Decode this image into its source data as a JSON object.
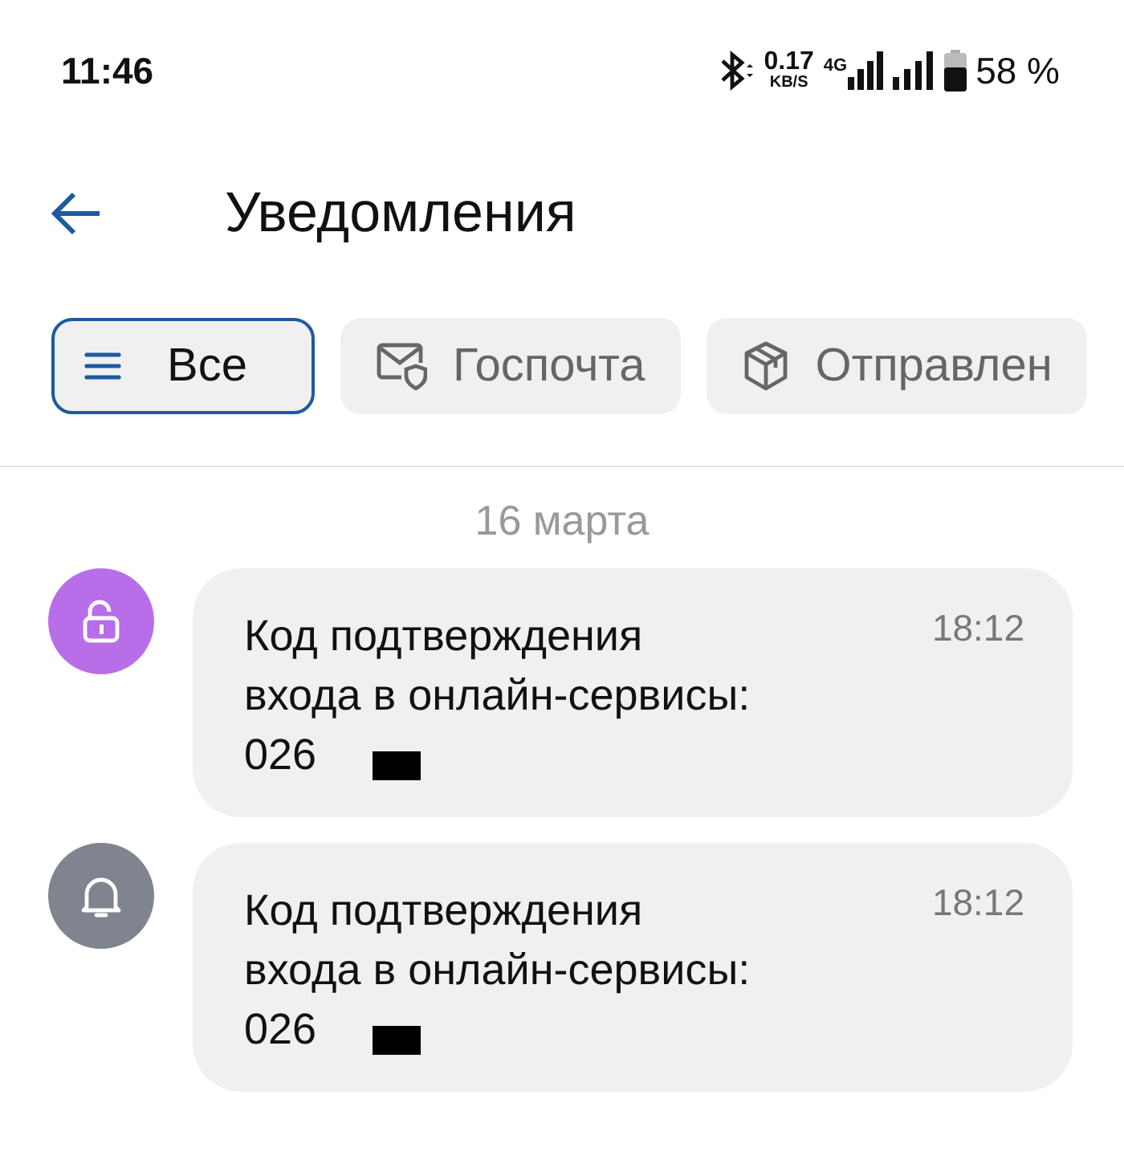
{
  "status_bar": {
    "time": "11:46",
    "speed": "0.17",
    "speed_unit": "KB/S",
    "network": "4G",
    "battery": "58 %"
  },
  "header": {
    "title": "Уведомления"
  },
  "filters": [
    {
      "label": "Все",
      "kind": "all",
      "selected": true
    },
    {
      "label": "Госпочта",
      "kind": "mail",
      "selected": false
    },
    {
      "label": "Отправлен",
      "kind": "parcel",
      "selected": false
    }
  ],
  "date": "16 марта",
  "notifications": [
    {
      "kind": "login",
      "color": "#b86ee8",
      "lines": [
        "Код подтверждения",
        "входа в онлайн-сервисы:",
        "026"
      ],
      "time": "18:12",
      "redacted": true
    },
    {
      "kind": "alert",
      "color": "#80848e",
      "lines": [
        "Код подтверждения",
        "входа в онлайн-сервисы:",
        "026"
      ],
      "time": "18:12",
      "redacted": true
    }
  ]
}
